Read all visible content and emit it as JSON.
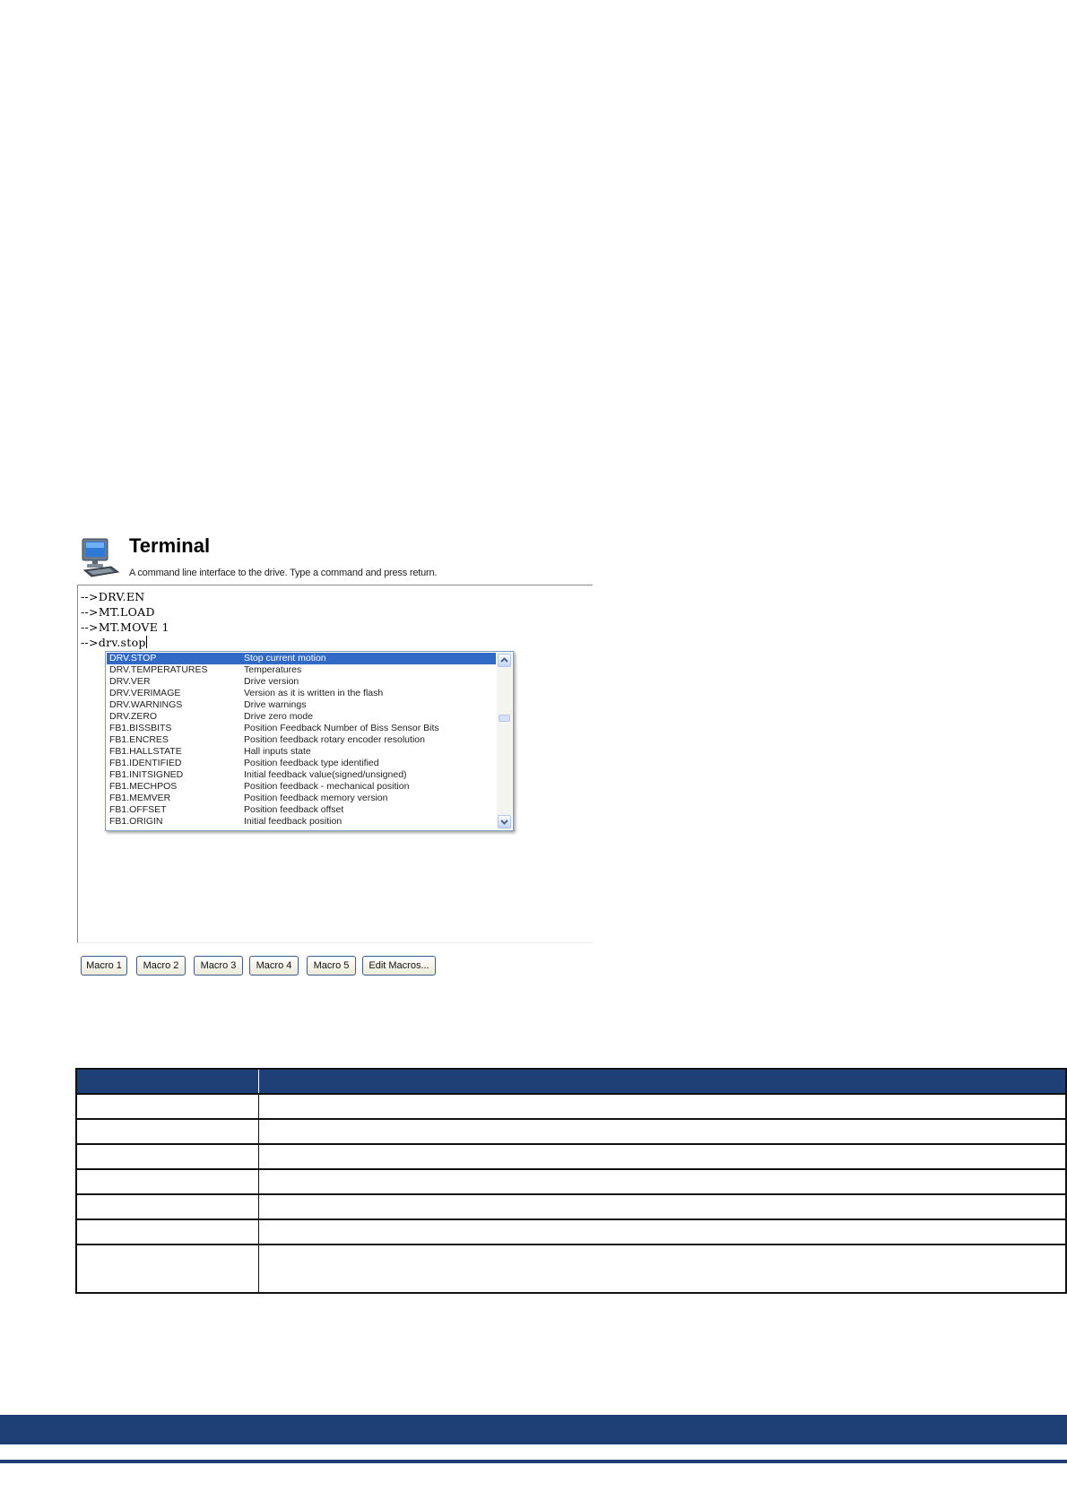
{
  "terminal": {
    "title": "Terminal",
    "subtitle": "A command line interface to the drive. Type a command and press return.",
    "lines": [
      "-->DRV.EN",
      "-->MT.LOAD",
      "-->MT.MOVE 1"
    ],
    "input_prompt": "-->",
    "input_value": "drv.stop"
  },
  "autocomplete": {
    "selected_index": 0,
    "items": [
      {
        "command": "DRV.STOP",
        "description": "Stop current motion"
      },
      {
        "command": "DRV.TEMPERATURES",
        "description": "Temperatures"
      },
      {
        "command": "DRV.VER",
        "description": "Drive version"
      },
      {
        "command": "DRV.VERIMAGE",
        "description": "Version as it is written in the flash"
      },
      {
        "command": "DRV.WARNINGS",
        "description": "Drive warnings"
      },
      {
        "command": "DRV.ZERO",
        "description": "Drive zero mode"
      },
      {
        "command": "FB1.BISSBITS",
        "description": "Position Feedback Number of Biss Sensor Bits"
      },
      {
        "command": "FB1.ENCRES",
        "description": "Position feedback rotary encoder resolution"
      },
      {
        "command": "FB1.HALLSTATE",
        "description": "Hall inputs state"
      },
      {
        "command": "FB1.IDENTIFIED",
        "description": "Position feedback type identified"
      },
      {
        "command": "FB1.INITSIGNED",
        "description": "Initial feedback value(signed/unsigned)"
      },
      {
        "command": "FB1.MECHPOS",
        "description": "Position feedback - mechanical position"
      },
      {
        "command": "FB1.MEMVER",
        "description": "Position feedback memory version"
      },
      {
        "command": "FB1.OFFSET",
        "description": "Position feedback offset"
      },
      {
        "command": "FB1.ORIGIN",
        "description": "Initial feedback position"
      }
    ]
  },
  "macros": {
    "buttons": [
      "Macro 1",
      "Macro 2",
      "Macro 3",
      "Macro 4",
      "Macro 5",
      "Edit Macros..."
    ]
  },
  "table": {
    "header": [
      "",
      ""
    ],
    "rows": [
      [
        "",
        ""
      ],
      [
        "",
        ""
      ],
      [
        "",
        ""
      ],
      [
        "",
        ""
      ],
      [
        "",
        ""
      ],
      [
        "",
        ""
      ],
      [
        "",
        ""
      ]
    ]
  },
  "colors": {
    "accent": "#1f3f77",
    "selection": "#316ac5"
  }
}
